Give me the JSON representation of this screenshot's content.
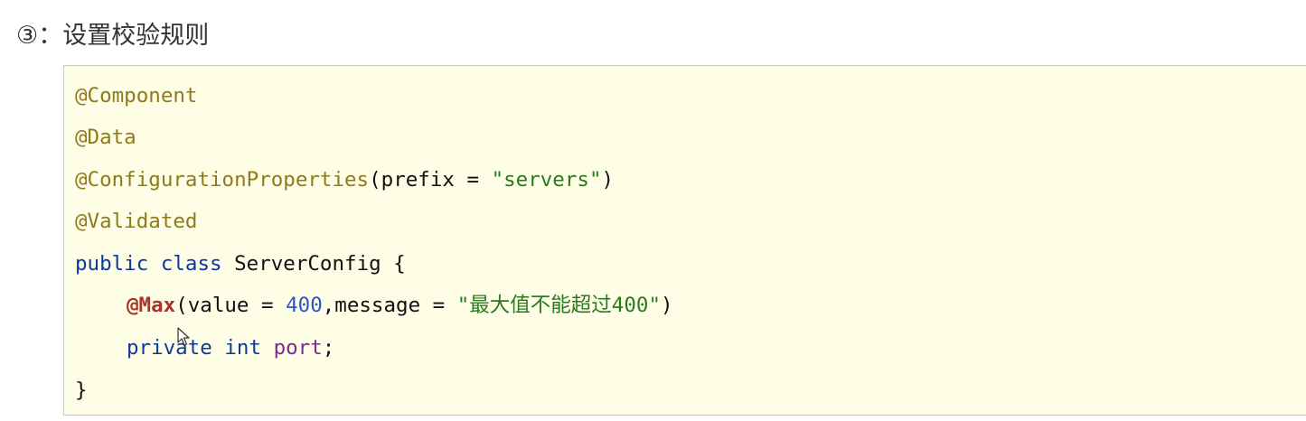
{
  "heading": {
    "text": "③：设置校验规则"
  },
  "code": {
    "line1": {
      "anno": "@Component"
    },
    "line2": {
      "anno": "@Data"
    },
    "line3": {
      "anno": "@ConfigurationProperties",
      "open": "(prefix = ",
      "str": "\"servers\"",
      "close": ")"
    },
    "line4": {
      "anno": "@Validated"
    },
    "line5": {
      "kw1": "public",
      "kw2": "class",
      "name": "ServerConfig {"
    },
    "line6": {
      "anno": "@Max",
      "open": "(value = ",
      "num": "400",
      "mid": ",message = ",
      "str": "\"最大值不能超过400\"",
      "close": ")"
    },
    "line7": {
      "kw1": "private",
      "kw2": "int",
      "field": "port",
      "end": ";"
    },
    "line8": {
      "text": "}"
    }
  },
  "icons": {
    "cursor": "mouse-pointer-icon"
  }
}
